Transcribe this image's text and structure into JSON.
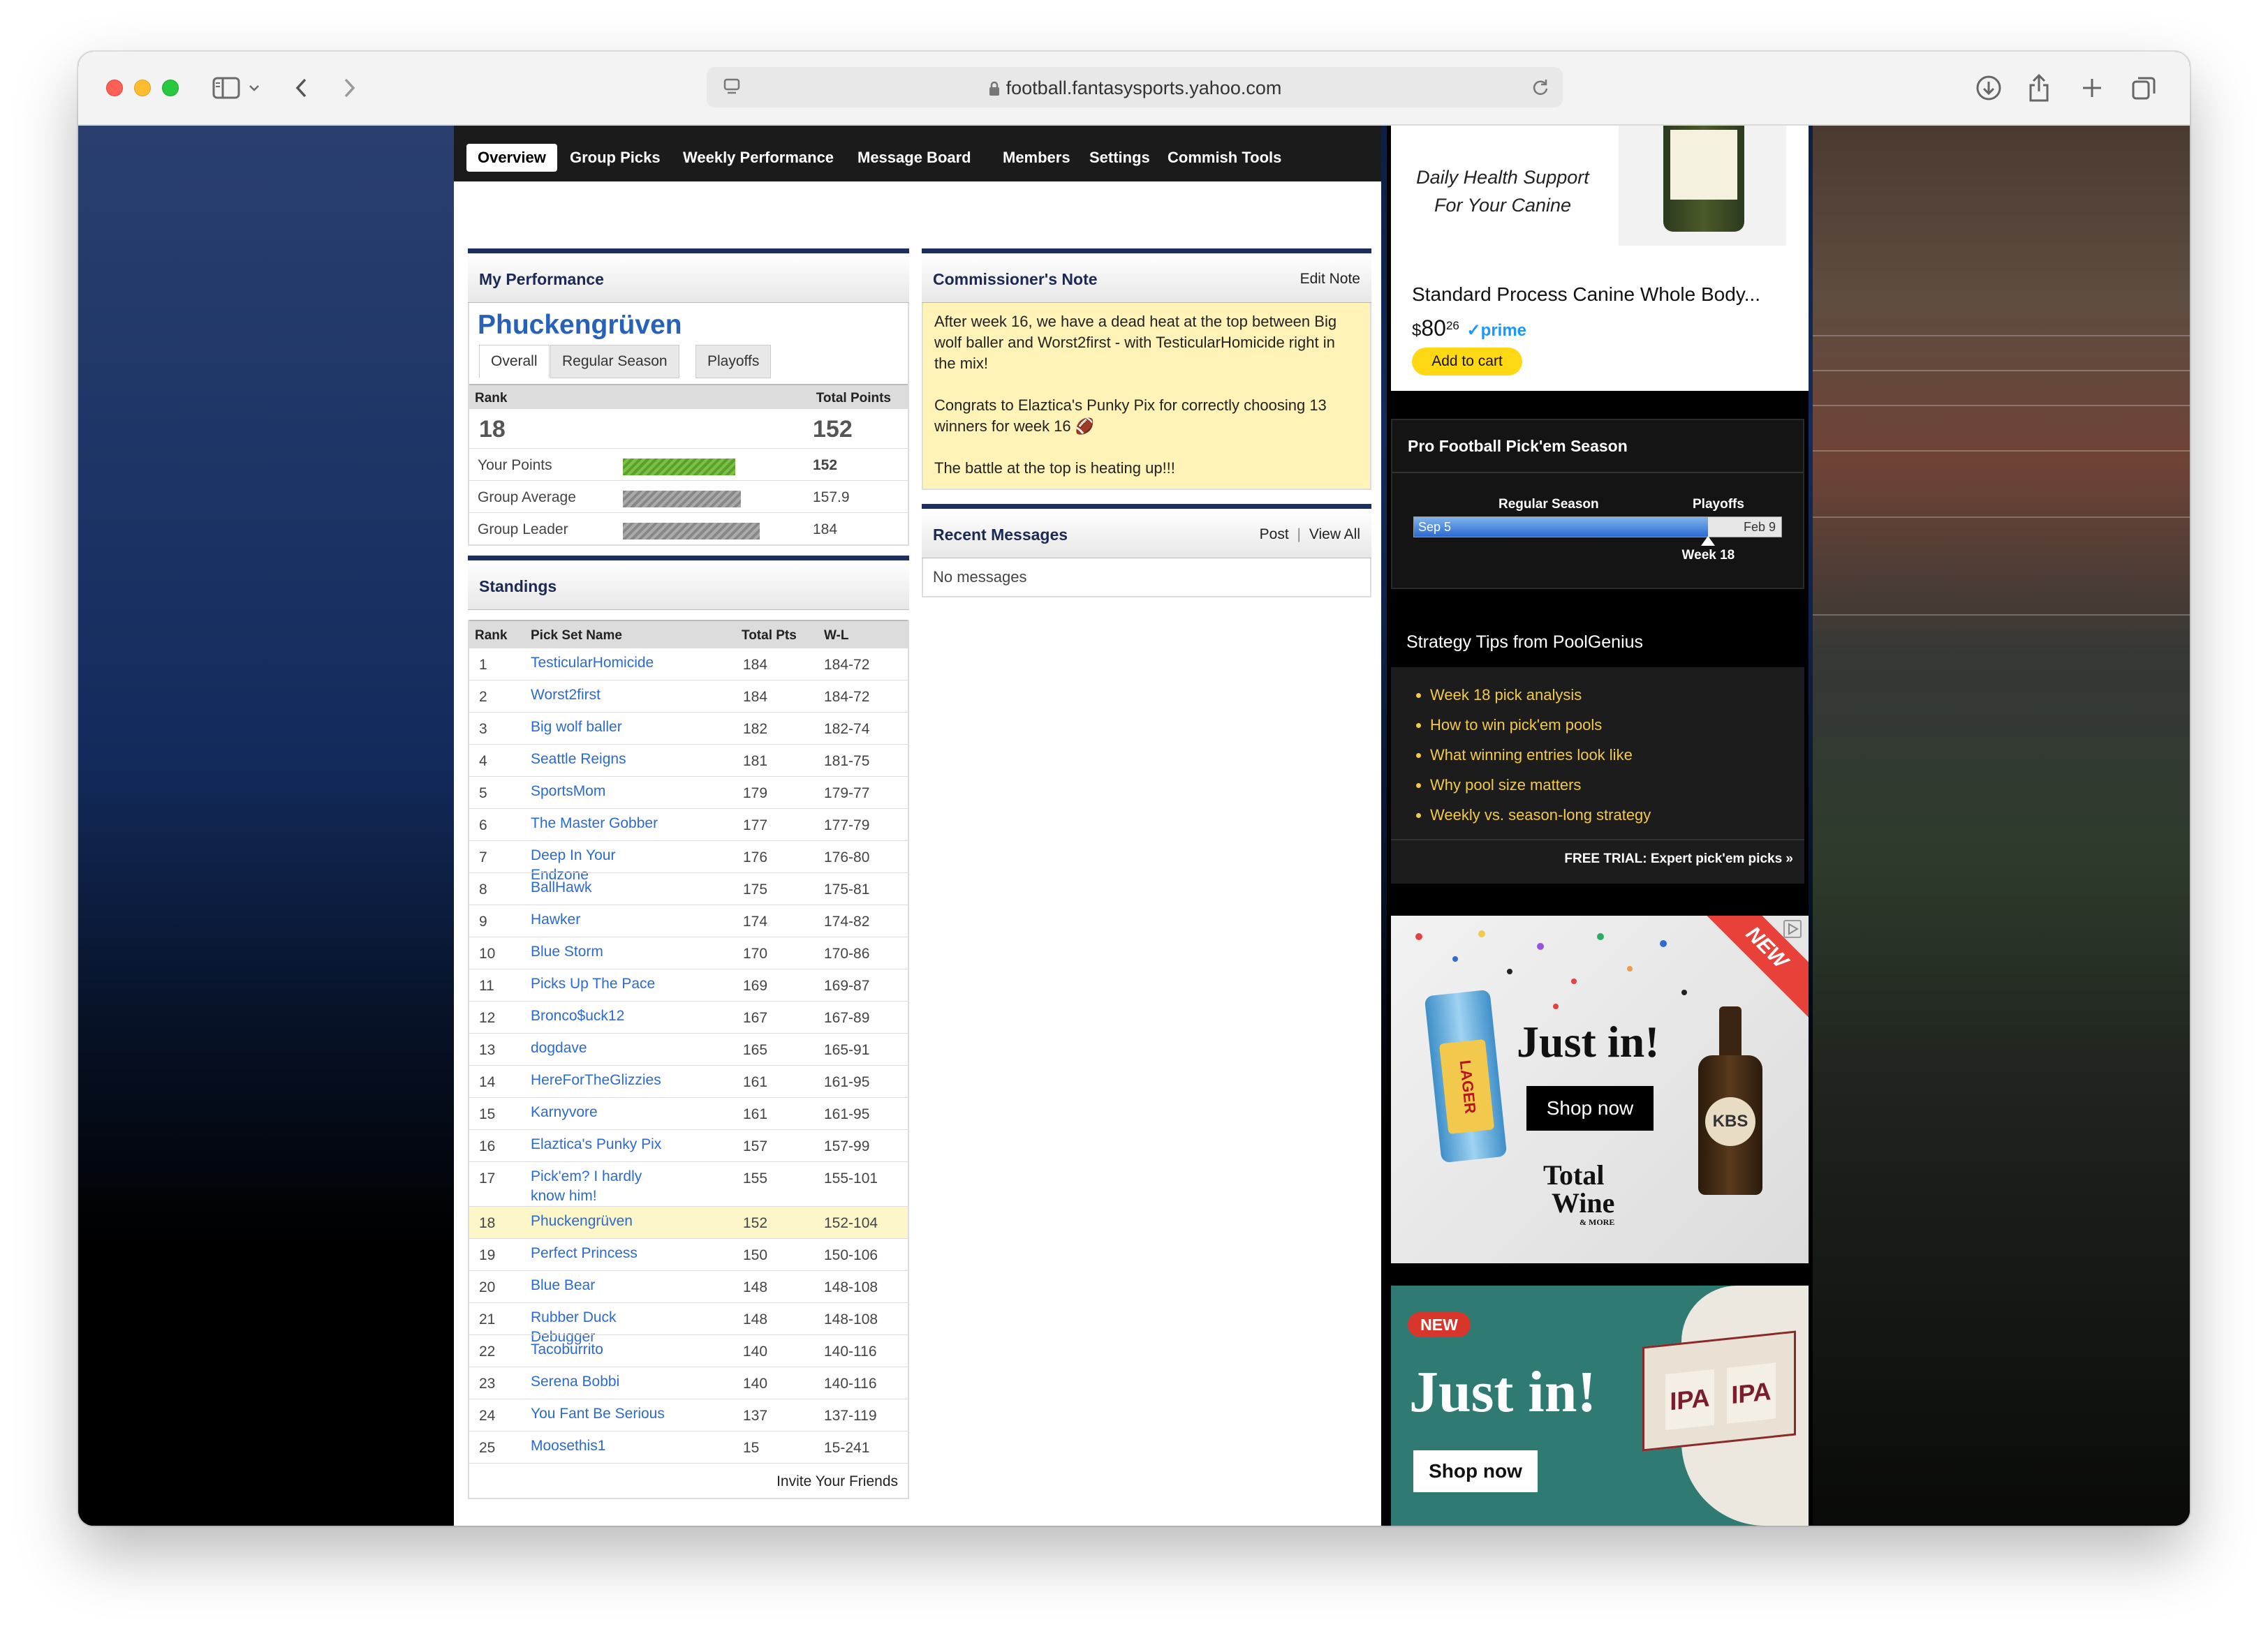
{
  "browser": {
    "url": "football.fantasysports.yahoo.com"
  },
  "nav": {
    "items": [
      "Overview",
      "Group Picks",
      "Weekly Performance",
      "Message Board",
      "Members",
      "Settings",
      "Commish Tools"
    ]
  },
  "performance": {
    "title": "My Performance",
    "team": "Phuckengrüven",
    "tabs": [
      "Overall",
      "Regular Season",
      "Playoffs"
    ],
    "rank_label": "Rank",
    "points_label": "Total Points",
    "rank": "18",
    "points": "152",
    "rows": [
      {
        "label": "Your Points",
        "value": "152",
        "fraction": 0.82
      },
      {
        "label": "Group Average",
        "value": "157.9",
        "fraction": 0.86
      },
      {
        "label": "Group Leader",
        "value": "184",
        "fraction": 1.0
      }
    ]
  },
  "standings": {
    "title": "Standings",
    "headers": [
      "Rank",
      "Pick Set Name",
      "Total Pts",
      "W-L"
    ],
    "rows": [
      [
        "1",
        "TesticularHomicide",
        "184",
        "184-72"
      ],
      [
        "2",
        "Worst2first",
        "184",
        "184-72"
      ],
      [
        "3",
        "Big wolf baller",
        "182",
        "182-74"
      ],
      [
        "4",
        "Seattle Reigns",
        "181",
        "181-75"
      ],
      [
        "5",
        "SportsMom",
        "179",
        "179-77"
      ],
      [
        "6",
        "The Master Gobber",
        "177",
        "177-79"
      ],
      [
        "7",
        "Deep In Your Endzone",
        "176",
        "176-80"
      ],
      [
        "8",
        "BallHawk",
        "175",
        "175-81"
      ],
      [
        "9",
        "Hawker",
        "174",
        "174-82"
      ],
      [
        "10",
        "Blue Storm",
        "170",
        "170-86"
      ],
      [
        "11",
        "Picks Up The Pace",
        "169",
        "169-87"
      ],
      [
        "12",
        "Bronco$uck12",
        "167",
        "167-89"
      ],
      [
        "13",
        "dogdave",
        "165",
        "165-91"
      ],
      [
        "14",
        "HereForTheGlizzies",
        "161",
        "161-95"
      ],
      [
        "15",
        "Karnyvore",
        "161",
        "161-95"
      ],
      [
        "16",
        "Elaztica's Punky Pix",
        "157",
        "157-99"
      ],
      [
        "17",
        "Pick'em? I hardly know him!",
        "155",
        "155-101"
      ],
      [
        "18",
        "Phuckengrüven",
        "152",
        "152-104"
      ],
      [
        "19",
        "Perfect Princess",
        "150",
        "150-106"
      ],
      [
        "20",
        "Blue Bear",
        "148",
        "148-108"
      ],
      [
        "21",
        "Rubber Duck Debugger",
        "148",
        "148-108"
      ],
      [
        "22",
        "Tacoburrito",
        "140",
        "140-116"
      ],
      [
        "23",
        "Serena Bobbi",
        "140",
        "140-116"
      ],
      [
        "24",
        "You Fant Be Serious",
        "137",
        "137-119"
      ],
      [
        "25",
        "Moosethis1",
        "15",
        "15-241"
      ]
    ],
    "invite": "Invite Your Friends"
  },
  "commish": {
    "title": "Commissioner's Note",
    "edit": "Edit Note",
    "p1": "After week 16, we have a dead heat at the top between Big wolf baller and Worst2first - with TesticularHomicide right in the mix!",
    "p2": "Congrats to Elaztica's Punky Pix for correctly choosing 13 winners for week 16 🏈",
    "p3": "The battle at the top is heating up!!!"
  },
  "messages": {
    "title": "Recent Messages",
    "post": "Post",
    "sep": "|",
    "view_all": "View All",
    "empty": "No messages"
  },
  "amazon_ad": {
    "tagline1": "Daily Health Support",
    "tagline2": "For Your Canine",
    "product": "Standard Process Canine Whole Body...",
    "dollar": "$",
    "price_main": "80",
    "price_cents": "26",
    "prime": "prime",
    "cta": "Add to cart"
  },
  "pickem_season": {
    "title": "Pro Football Pick'em Season",
    "regular": "Regular Season",
    "playoffs": "Playoffs",
    "start": "Sep 5",
    "end": "Feb 9",
    "week": "Week 18",
    "progress_fraction": 0.8
  },
  "tips": {
    "title": "Strategy Tips from PoolGenius",
    "items": [
      "Week 18 pick analysis",
      "How to win pick'em pools",
      "What winning entries look like",
      "Why pool size matters",
      "Weekly vs. season-long strategy"
    ],
    "cta": "FREE TRIAL: Expert pick'em picks »"
  },
  "ad1": {
    "new": "NEW",
    "headline": "Just in!",
    "cta": "Shop now",
    "brand_line1": "Total",
    "brand_line2": "Wine",
    "brand_line3": "& MORE",
    "can_text": "LAGER",
    "bottle_text": "KBS"
  },
  "ad2": {
    "new": "NEW",
    "headline": "Just in!",
    "cta": "Shop now",
    "label": "IPA"
  },
  "colors": {
    "link": "#2a6ad1",
    "header_navy": "#1d2d5c",
    "note_bg": "#fff3b8",
    "highlight_row": "#fdf6c9",
    "tip_link": "#f2c94c"
  }
}
